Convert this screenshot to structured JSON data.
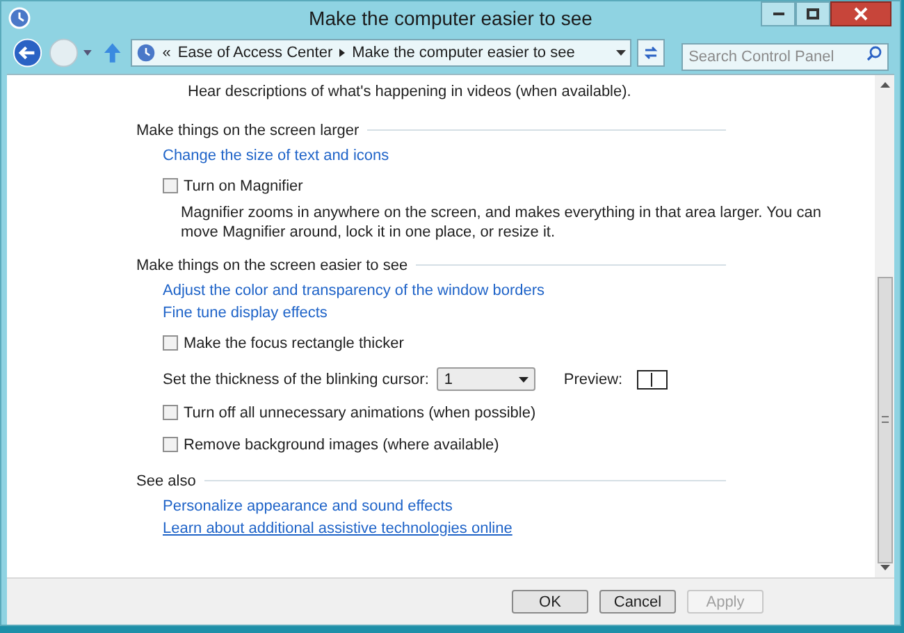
{
  "window": {
    "title": "Make the computer easier to see"
  },
  "address": {
    "overflow_mark": "«",
    "breadcrumbs": [
      "Ease of Access Center",
      "Make the computer easier to see"
    ]
  },
  "search": {
    "placeholder": "Search Control Panel"
  },
  "top_text": "Hear descriptions of what's happening in videos (when available).",
  "sections": [
    {
      "heading": "Make things on the screen larger",
      "items": [
        {
          "kind": "link",
          "text": "Change the size of text and icons",
          "focused": false
        },
        {
          "kind": "checkbox",
          "label": "Turn on Magnifier",
          "checked": false
        },
        {
          "kind": "description",
          "text": "Magnifier zooms in anywhere on the screen, and makes everything in that area larger. You can move Magnifier around, lock it in one place, or resize it."
        }
      ]
    },
    {
      "heading": "Make things on the screen easier to see",
      "items": [
        {
          "kind": "link",
          "text": "Adjust the color and transparency of the window borders",
          "focused": false
        },
        {
          "kind": "link",
          "text": "Fine tune display effects",
          "focused": false
        },
        {
          "kind": "checkbox",
          "label": "Make the focus rectangle thicker",
          "checked": false
        },
        {
          "kind": "dropdown",
          "label": "Set the thickness of the blinking cursor:",
          "value": "1",
          "preview_label": "Preview:"
        },
        {
          "kind": "checkbox",
          "label": "Turn off all unnecessary animations (when possible)",
          "checked": false
        },
        {
          "kind": "checkbox",
          "label": "Remove background images (where available)",
          "checked": false
        }
      ]
    },
    {
      "heading": "See also",
      "items": [
        {
          "kind": "link",
          "text": "Personalize appearance and sound effects",
          "focused": false
        },
        {
          "kind": "link",
          "text": "Learn about additional assistive technologies online",
          "focused": true
        }
      ]
    }
  ],
  "buttons": [
    {
      "label": "OK",
      "disabled": false
    },
    {
      "label": "Cancel",
      "disabled": false
    },
    {
      "label": "Apply",
      "disabled": true
    }
  ]
}
